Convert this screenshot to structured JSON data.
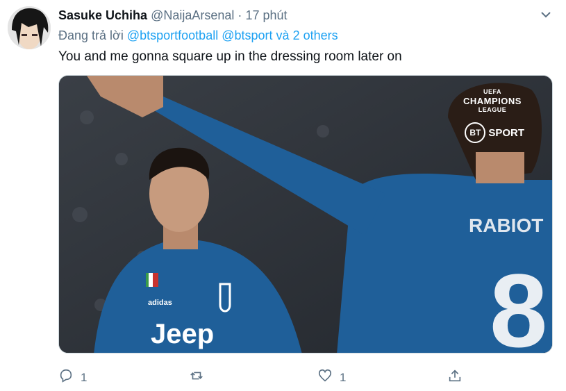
{
  "tweet": {
    "display_name": "Sasuke Uchiha",
    "handle": "@NaijaArsenal",
    "separator": "·",
    "time": "17 phút",
    "reply_prefix": "Đang trả lời",
    "reply_mention_1": "@btsportfootball",
    "reply_mention_2": "@btsport",
    "reply_and": "và",
    "reply_others": "2 others",
    "text": "You and me gonna square up in the dressing room later on"
  },
  "media": {
    "ucl_top": "UEFA",
    "ucl_name": "CHAMPIONS",
    "ucl_league": "LEAGUE",
    "bt_mark": "BT",
    "bt_sport": "SPORT",
    "jersey_sponsor": "Jeep",
    "jersey_name": "RABIOT",
    "jersey_number": "8"
  },
  "actions": {
    "reply_count": "1",
    "retweet_count": "",
    "like_count": "1"
  },
  "icons": {
    "more": "chevron-down-icon",
    "reply": "reply-icon",
    "retweet": "retweet-icon",
    "like": "heart-icon",
    "share": "share-icon"
  },
  "colors": {
    "link": "#1da1f2",
    "secondary": "#5b7083",
    "jersey": "#1f5f99"
  }
}
